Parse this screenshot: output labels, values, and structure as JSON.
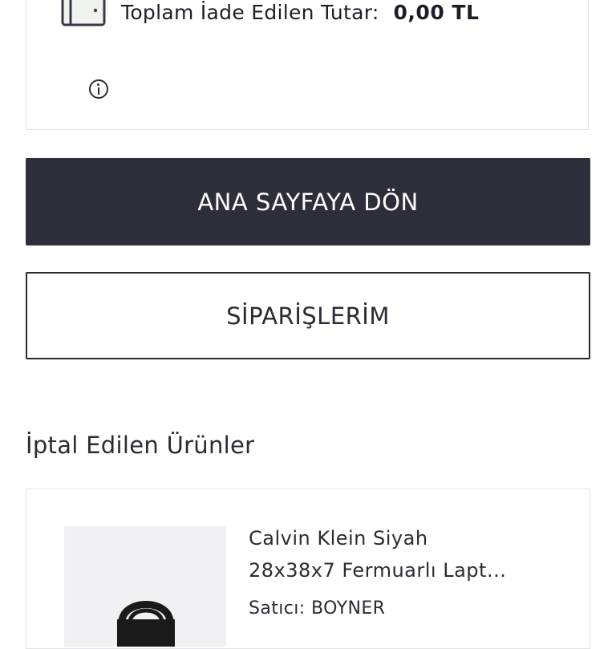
{
  "refund": {
    "label": "Toplam İade Edilen Tutar:",
    "amount": "0,00 TL",
    "icon": "wallet-icon",
    "info_icon": "info-icon"
  },
  "buttons": {
    "home": "ANA SAYFAYA DÖN",
    "orders": "SİPARİŞLERİM"
  },
  "cancelled_section": {
    "title": "İptal Edilen Ürünler",
    "products": [
      {
        "name_line1": "Calvin Klein Siyah",
        "name_line2": "28x38x7 Fermuarlı Lapt...",
        "seller": "Satıcı: BOYNER",
        "image_icon": "bag-icon"
      }
    ]
  },
  "colors": {
    "primary_dark": "#2e2e3a",
    "border": "#e3e3e6",
    "text": "#2b2b35"
  }
}
